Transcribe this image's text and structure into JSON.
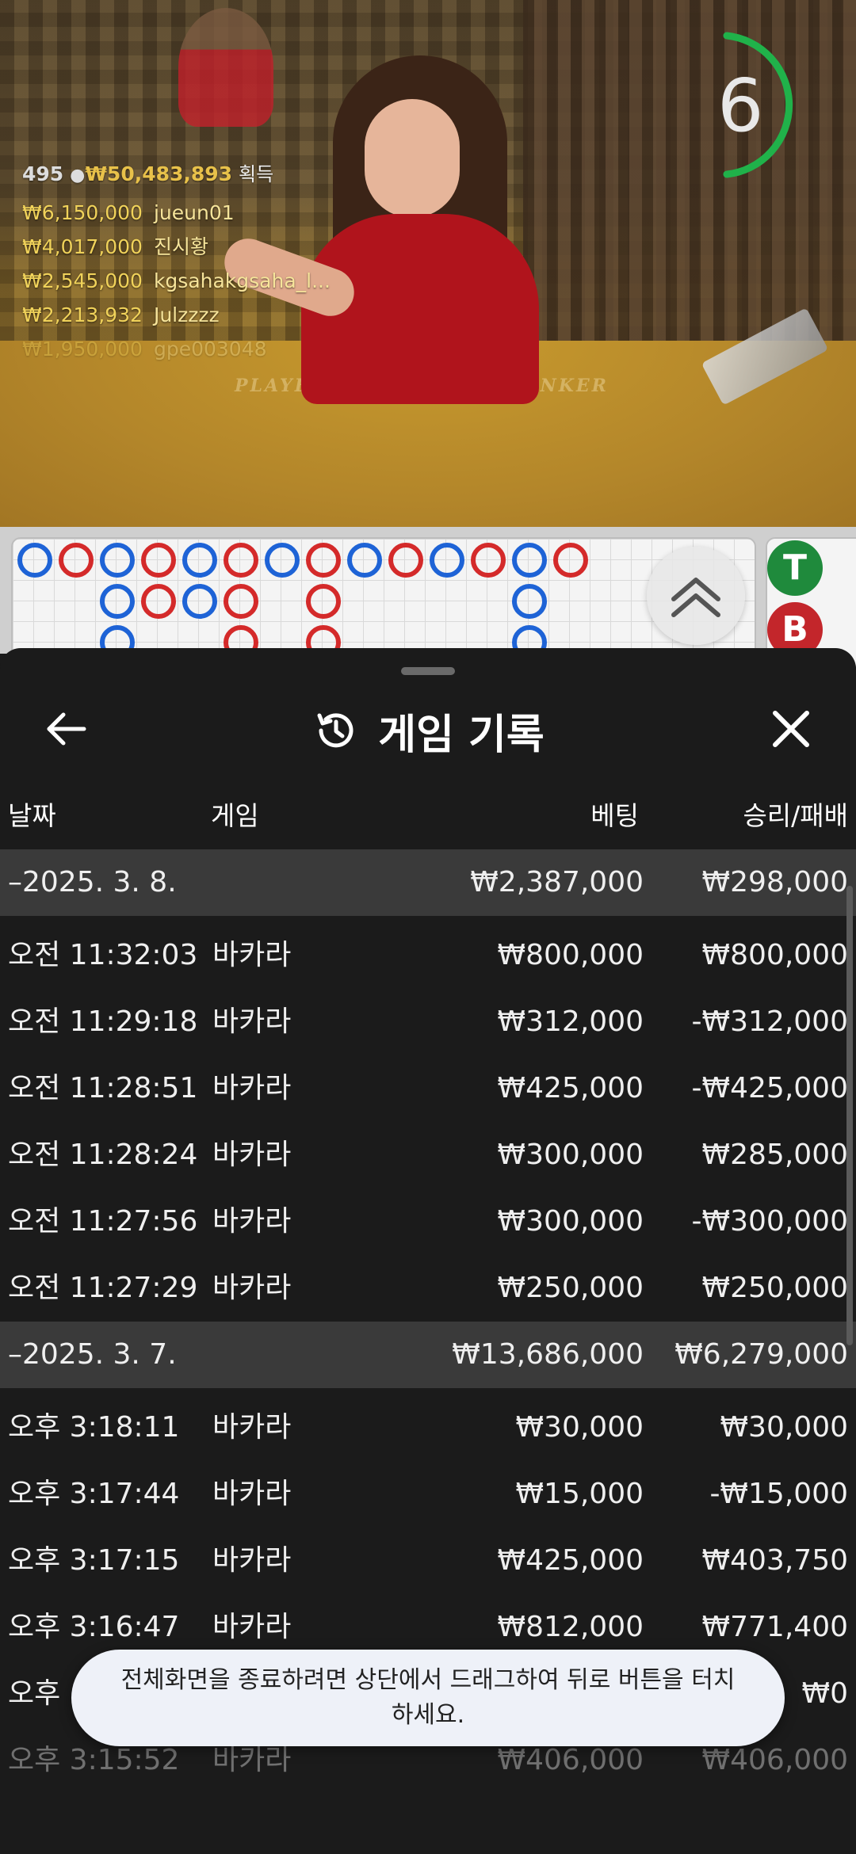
{
  "video": {
    "countdown": "6",
    "felt_left": "PLAYER",
    "felt_right": "BANKER",
    "winners_count": "495",
    "winners_total": "₩50,483,893",
    "winners_suffix": "획득",
    "winners": [
      {
        "amount": "₩6,150,000",
        "name": "jueun01"
      },
      {
        "amount": "₩4,017,000",
        "name": "진시황"
      },
      {
        "amount": "₩2,545,000",
        "name": "kgsahakgsaha_l..."
      },
      {
        "amount": "₩2,213,932",
        "name": "Julzzzz"
      },
      {
        "amount": "₩1,950,000",
        "name": "gpe003048"
      }
    ],
    "badge_tie": "T",
    "badge_banker": "B"
  },
  "colors": {
    "player": "#1e63d6",
    "banker": "#d42a2a",
    "tie": "#1f8a3c",
    "sheet": "#1b1b1b",
    "group_row": "#3a3a3a"
  },
  "sheet": {
    "title": "게임 기록",
    "icons": {
      "back": "arrow-left-icon",
      "history": "history-icon",
      "close": "close-icon"
    },
    "columns": {
      "date": "날짜",
      "game": "게임",
      "bet": "베팅",
      "result": "승리/패배"
    },
    "groups": [
      {
        "label": "–2025. 3. 8.",
        "bet": "₩2,387,000",
        "result": "₩298,000",
        "rows": [
          {
            "time": "오전 11:32:03",
            "game": "바카라",
            "bet": "₩800,000",
            "result": "₩800,000"
          },
          {
            "time": "오전 11:29:18",
            "game": "바카라",
            "bet": "₩312,000",
            "result": "-₩312,000"
          },
          {
            "time": "오전 11:28:51",
            "game": "바카라",
            "bet": "₩425,000",
            "result": "-₩425,000"
          },
          {
            "time": "오전 11:28:24",
            "game": "바카라",
            "bet": "₩300,000",
            "result": "₩285,000"
          },
          {
            "time": "오전 11:27:56",
            "game": "바카라",
            "bet": "₩300,000",
            "result": "-₩300,000"
          },
          {
            "time": "오전 11:27:29",
            "game": "바카라",
            "bet": "₩250,000",
            "result": "₩250,000"
          }
        ]
      },
      {
        "label": "–2025. 3. 7.",
        "bet": "₩13,686,000",
        "result": "₩6,279,000",
        "rows": [
          {
            "time": "오후 3:18:11",
            "game": "바카라",
            "bet": "₩30,000",
            "result": "₩30,000"
          },
          {
            "time": "오후 3:17:44",
            "game": "바카라",
            "bet": "₩15,000",
            "result": "-₩15,000"
          },
          {
            "time": "오후 3:17:15",
            "game": "바카라",
            "bet": "₩425,000",
            "result": "₩403,750"
          },
          {
            "time": "오후 3:16:47",
            "game": "바카라",
            "bet": "₩812,000",
            "result": "₩771,400"
          },
          {
            "time": "오후",
            "game": "",
            "bet": "",
            "result": "₩0"
          },
          {
            "time": "오후 3:15:52",
            "game": "바카라",
            "bet": "₩406,000",
            "result": "₩406,000"
          }
        ]
      }
    ]
  },
  "toast": {
    "message": "전체화면을 종료하려면 상단에서 드래그하여 뒤로 버튼을 터치하세요."
  }
}
